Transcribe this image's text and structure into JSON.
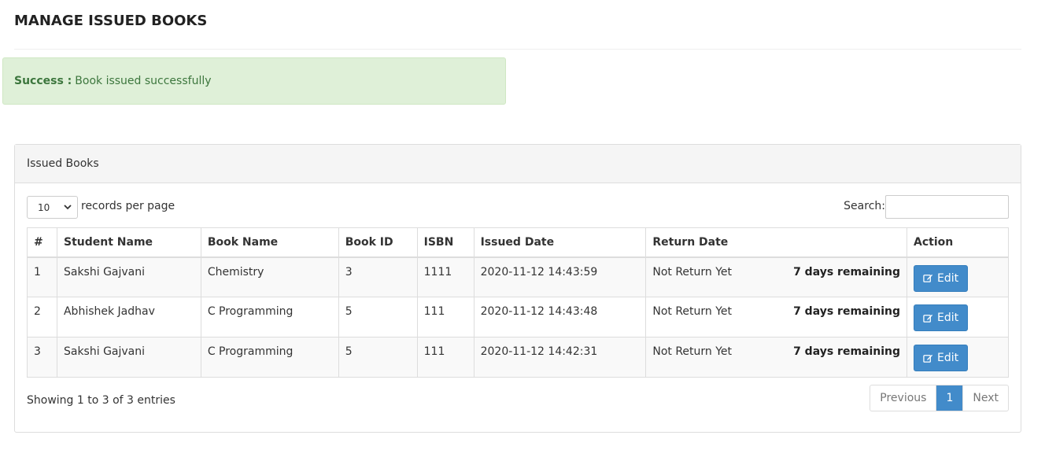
{
  "page": {
    "title": "MANAGE ISSUED BOOKS"
  },
  "alert": {
    "label": "Success :",
    "message": "Book issued successfully"
  },
  "panel": {
    "heading": "Issued Books"
  },
  "controls": {
    "length_value": "10",
    "length_label": "records per page",
    "search_label": "Search:"
  },
  "table": {
    "headers": [
      "#",
      "Student Name",
      "Book Name",
      "Book ID",
      "ISBN",
      "Issued Date",
      "Return Date",
      "Action"
    ],
    "rows": [
      {
        "num": "1",
        "student": "Sakshi Gajvani",
        "book": "Chemistry",
        "book_id": "3",
        "isbn": "1111",
        "issued": "2020-11-12 14:43:59",
        "return": "Not Return Yet",
        "remaining": "7 days remaining",
        "action": "Edit"
      },
      {
        "num": "2",
        "student": "Abhishek Jadhav",
        "book": "C Programming",
        "book_id": "5",
        "isbn": "111",
        "issued": "2020-11-12 14:43:48",
        "return": "Not Return Yet",
        "remaining": "7 days remaining",
        "action": "Edit"
      },
      {
        "num": "3",
        "student": "Sakshi Gajvani",
        "book": "C Programming",
        "book_id": "5",
        "isbn": "111",
        "issued": "2020-11-12 14:42:31",
        "return": "Not Return Yet",
        "remaining": "7 days remaining",
        "action": "Edit"
      }
    ]
  },
  "footer": {
    "info": "Showing 1 to 3 of 3 entries",
    "prev": "Previous",
    "current": "1",
    "next": "Next"
  },
  "colors": {
    "primary": "#428bca",
    "success_bg": "#dff0d8",
    "success_text": "#3c763d"
  }
}
